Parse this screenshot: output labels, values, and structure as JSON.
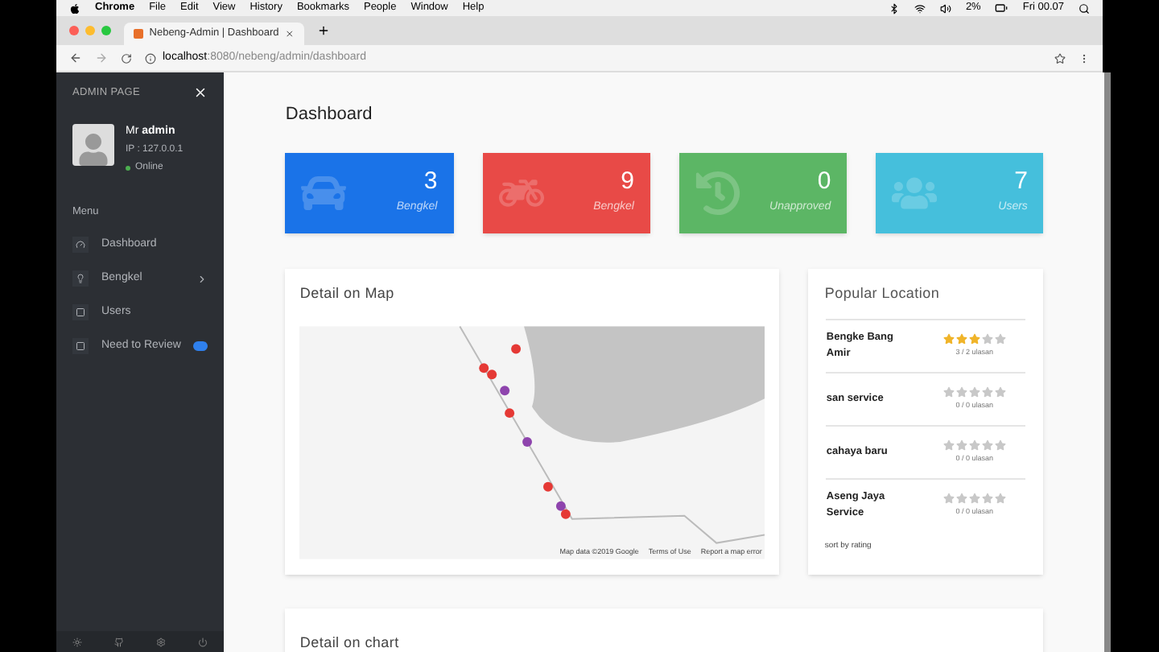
{
  "menubar": {
    "app": "Chrome",
    "menus": [
      "File",
      "Edit",
      "View",
      "History",
      "Bookmarks",
      "People",
      "Window",
      "Help"
    ],
    "battery": "2%",
    "clock": "Fri 00.07"
  },
  "browser": {
    "tab_title": "Nebeng-Admin | Dashboard",
    "url_host": "localhost",
    "url_path": ":8080/nebeng/admin/dashboard"
  },
  "sidebar": {
    "title": "ADMIN PAGE",
    "user": "Mr **admin**",
    "ip": "IP : 127.0.0.1",
    "status": "Online",
    "menu_label": "Menu",
    "items": [
      {
        "label": "Dashboard",
        "kind": "plain"
      },
      {
        "label": "Bengkel",
        "kind": "submenu"
      },
      {
        "label": "Users",
        "kind": "plain"
      },
      {
        "label": "Need to Review",
        "kind": "badge"
      }
    ]
  },
  "page_title": "Dashboard",
  "stats": [
    {
      "value": "3",
      "label": "Bengkel",
      "kind": "car",
      "color": "#1a73e8"
    },
    {
      "value": "9",
      "label": "Bengkel",
      "kind": "motorcycle",
      "color": "#e84a47"
    },
    {
      "value": "0",
      "label": "Unapproved",
      "kind": "history",
      "color": "#5cb665"
    },
    {
      "value": "7",
      "label": "Users",
      "kind": "users",
      "color": "#45bfdc"
    }
  ],
  "map_card": {
    "title": "Detail on Map",
    "attribution": [
      "Map data ©2019 Google",
      "Terms of Use",
      "Report a map error"
    ]
  },
  "popular": {
    "title": "Popular Location",
    "footer": "sort by rating",
    "rows": [
      {
        "name": "Bengke Bang Amir",
        "stars": 3,
        "reviews": "3 / 2 ulasan"
      },
      {
        "name": "san service",
        "stars": 0,
        "reviews": "0 / 0 ulasan"
      },
      {
        "name": "cahaya baru",
        "stars": 0,
        "reviews": "0 / 0 ulasan"
      },
      {
        "name": "Aseng Jaya Service",
        "stars": 0,
        "reviews": "0 / 0 ulasan"
      }
    ]
  },
  "chart_card": {
    "title": "Detail on chart"
  }
}
